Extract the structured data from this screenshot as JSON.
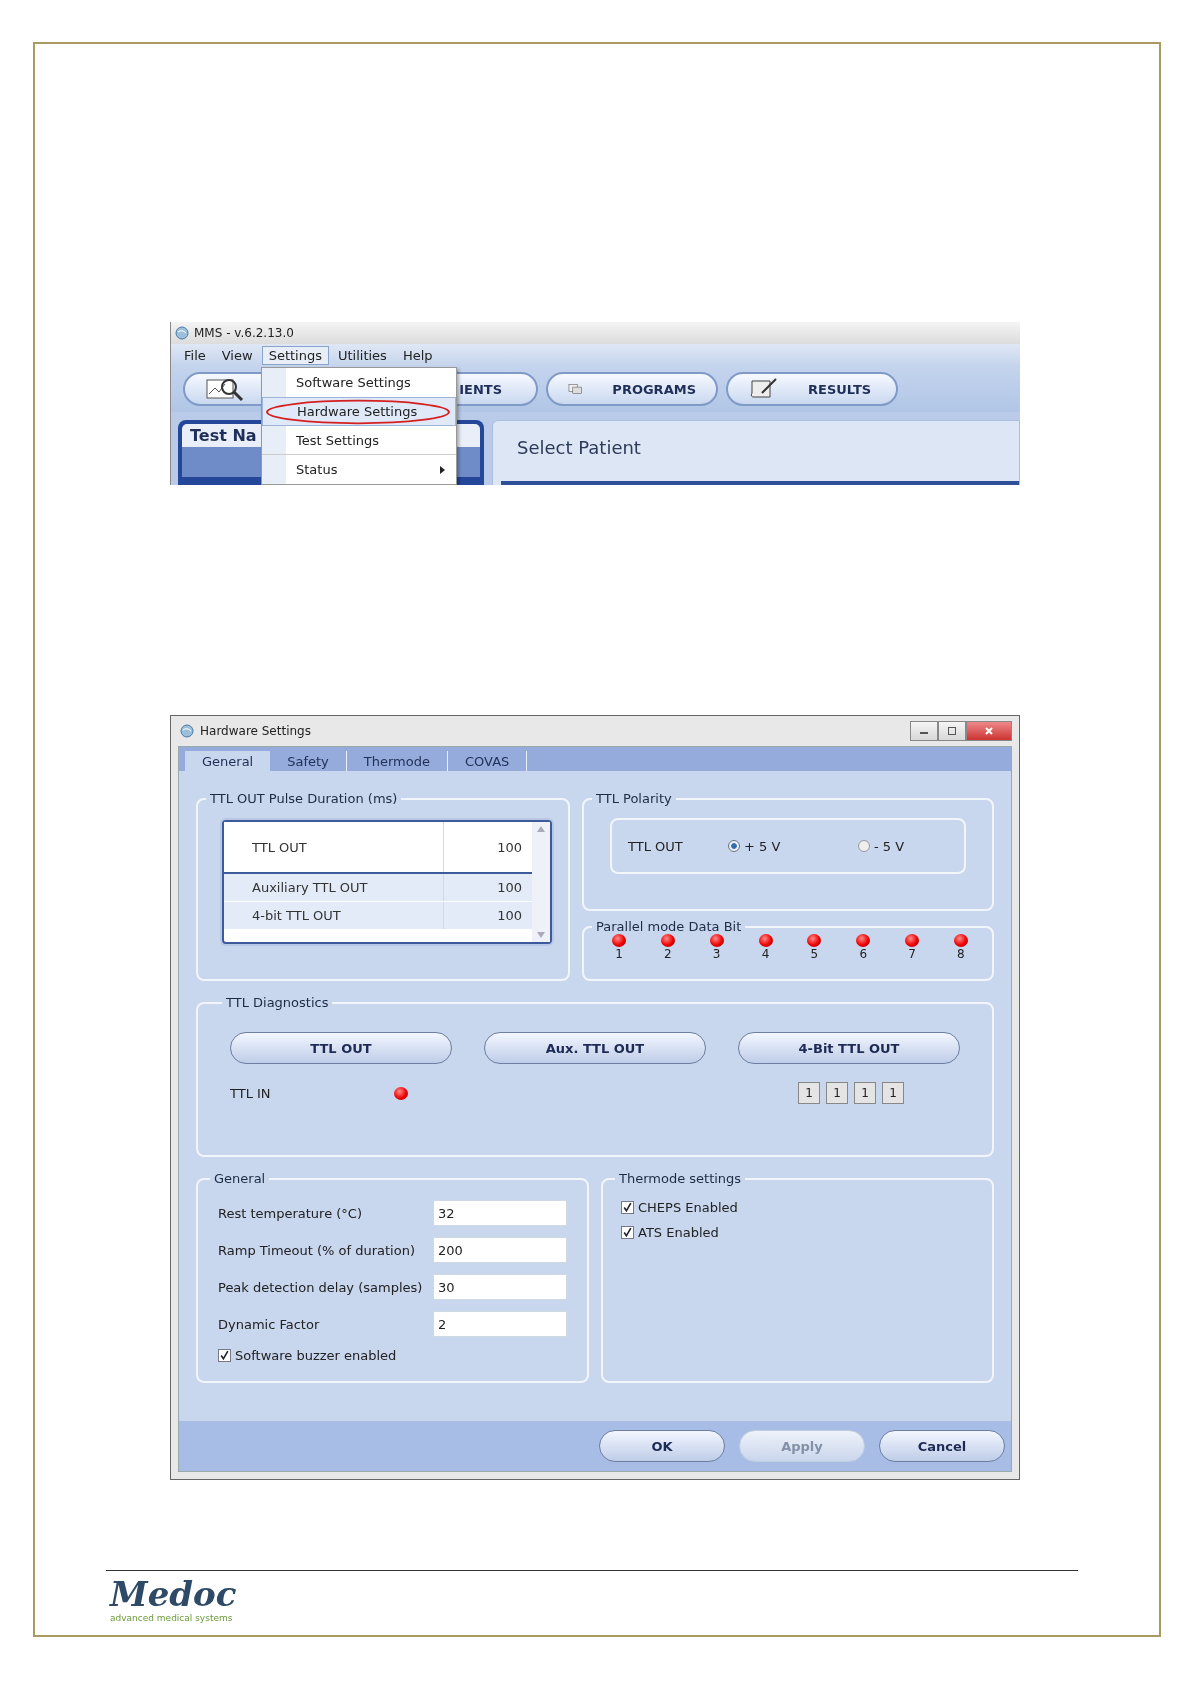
{
  "app_window": {
    "title": "MMS - v.6.2.13.0",
    "menu": [
      {
        "label": "File",
        "selected": false
      },
      {
        "label": "View",
        "selected": false
      },
      {
        "label": "Settings",
        "selected": true
      },
      {
        "label": "Utilities",
        "selected": false
      },
      {
        "label": "Help",
        "selected": false
      }
    ],
    "toolbar_buttons": [
      {
        "label": "IENTS"
      },
      {
        "label": "PROGRAMS"
      },
      {
        "label": "RESULTS"
      }
    ],
    "left_panel_title": "Test Na",
    "main_title": "Select Patient",
    "dropdown": [
      {
        "label": "Software Settings",
        "highlighted": false,
        "submenu": false
      },
      {
        "label": "Hardware Settings",
        "highlighted": true,
        "submenu": false
      },
      {
        "label": "Test Settings",
        "highlighted": false,
        "submenu": false
      },
      {
        "label": "Status",
        "highlighted": false,
        "submenu": true
      }
    ]
  },
  "dialog": {
    "title": "Hardware Settings",
    "tabs": [
      {
        "label": "General",
        "selected": true
      },
      {
        "label": "Safety",
        "selected": false
      },
      {
        "label": "Thermode",
        "selected": false
      },
      {
        "label": "COVAS",
        "selected": false
      }
    ],
    "pulse_duration": {
      "title": "TTL OUT Pulse Duration (ms)",
      "rows": [
        {
          "name": "TTL OUT",
          "value": "100",
          "selected": true
        },
        {
          "name": "Auxiliary TTL OUT",
          "value": "100",
          "selected": false
        },
        {
          "name": "4-bit TTL OUT",
          "value": "100",
          "selected": false
        }
      ]
    },
    "ttl_polarity": {
      "title": "TTL Polarity",
      "label": "TTL OUT",
      "options": [
        {
          "label": "+ 5 V",
          "selected": true
        },
        {
          "label": "- 5 V",
          "selected": false
        }
      ]
    },
    "parallel_bits": {
      "title": "Parallel mode Data Bit",
      "bits": [
        {
          "label": "1",
          "on": true
        },
        {
          "label": "2",
          "on": true
        },
        {
          "label": "3",
          "on": true
        },
        {
          "label": "4",
          "on": true
        },
        {
          "label": "5",
          "on": true
        },
        {
          "label": "6",
          "on": true
        },
        {
          "label": "7",
          "on": true
        },
        {
          "label": "8",
          "on": true
        }
      ]
    },
    "diagnostics": {
      "title": "TTL Diagnostics",
      "buttons": [
        "TTL OUT",
        "Aux. TTL OUT",
        "4-Bit TTL OUT"
      ],
      "ttl_in_label": "TTL IN",
      "ttl_in_on": true,
      "bit_values": [
        "1",
        "1",
        "1",
        "1"
      ]
    },
    "general": {
      "title": "General",
      "fields": [
        {
          "label": "Rest temperature (°C)",
          "value": "32"
        },
        {
          "label": "Ramp Timeout (% of duration)",
          "value": "200"
        },
        {
          "label": "Peak detection  delay (samples)",
          "value": "30"
        },
        {
          "label": "Dynamic Factor",
          "value": "2"
        }
      ],
      "checkbox": {
        "label": "Software buzzer enabled",
        "checked": true
      }
    },
    "thermode": {
      "title": "Thermode settings",
      "checkboxes": [
        {
          "label": "CHEPS Enabled",
          "checked": true
        },
        {
          "label": "ATS Enabled",
          "checked": true
        }
      ]
    },
    "buttons": [
      {
        "label": "OK",
        "disabled": false
      },
      {
        "label": "Apply",
        "disabled": true
      },
      {
        "label": "Cancel",
        "disabled": false
      }
    ]
  },
  "footer": {
    "logo": "Medoc",
    "tagline": "advanced medical systems"
  }
}
